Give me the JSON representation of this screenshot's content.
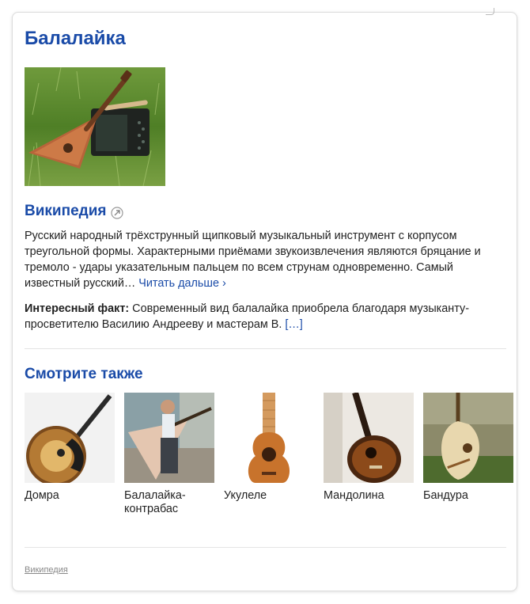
{
  "card": {
    "title": "Балалайка",
    "main_image_alt": "balalaika-photo"
  },
  "source": {
    "name": "Википедия",
    "icon": "external-link-icon"
  },
  "description": {
    "text": "Русский народный трёхструнный щипковый музыкальный инструмент с корпусом треугольной формы. Характерными приёмами звукоизвлечения являются бряцание и тремоло - удары указательным пальцем по всем струнам одновременно. Самый известный русский…",
    "more_label": "Читать дальше ›"
  },
  "fact": {
    "label": "Интересный факт:",
    "text": "Современный вид балалайка приобрела благодаря музыканту-просветителю Василию Андрееву и мастерам В.",
    "more_label": "[…]"
  },
  "see_also": {
    "title": "Смотрите также",
    "items": [
      {
        "label": "Домра"
      },
      {
        "label": "Балалайка-контрабас"
      },
      {
        "label": "Укулеле"
      },
      {
        "label": "Мандолина"
      },
      {
        "label": "Бандура"
      }
    ]
  },
  "footer": {
    "link": "Википедия"
  },
  "colors": {
    "link": "#1a4ba8",
    "text": "#222222",
    "muted": "#888888"
  }
}
